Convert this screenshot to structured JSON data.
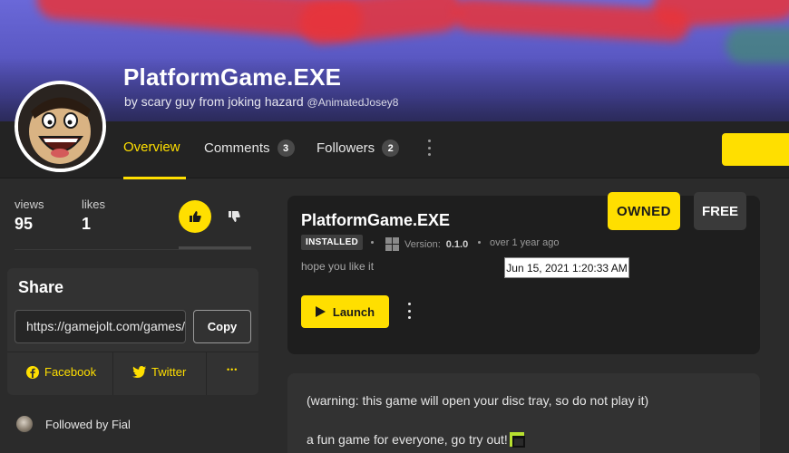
{
  "header": {
    "title": "PlatformGame.EXE",
    "byline": "by scary guy from joking hazard",
    "handle": "@AnimatedJosey8"
  },
  "nav": {
    "tabs": [
      {
        "label": "Overview"
      },
      {
        "label": "Comments",
        "count": "3"
      },
      {
        "label": "Followers",
        "count": "2"
      }
    ]
  },
  "stats": {
    "views_label": "views",
    "views": "95",
    "likes_label": "likes",
    "likes": "1"
  },
  "share": {
    "title": "Share",
    "url": "https://gamejolt.com/games/",
    "copy_label": "Copy",
    "facebook_label": "Facebook",
    "twitter_label": "Twitter",
    "more_label": "•••"
  },
  "followed": {
    "text": "Followed by Fial"
  },
  "release": {
    "title": "PlatformGame.EXE",
    "owned_label": "OWNED",
    "free_label": "FREE",
    "installed_label": "INSTALLED",
    "version_label": "Version:",
    "version": "0.1.0",
    "age": "over 1 year ago",
    "tooltip": "Jun 15, 2021 1:20:33 AM",
    "description": "hope you like it",
    "launch_label": "Launch"
  },
  "description": {
    "line1": "(warning: this game will open your disc tray, so do not play it)",
    "line2": "a fun game for everyone, go try out!"
  },
  "colors": {
    "accent": "#ffdf00",
    "background": "#2b2b2b",
    "banner": "#5b59c4"
  }
}
